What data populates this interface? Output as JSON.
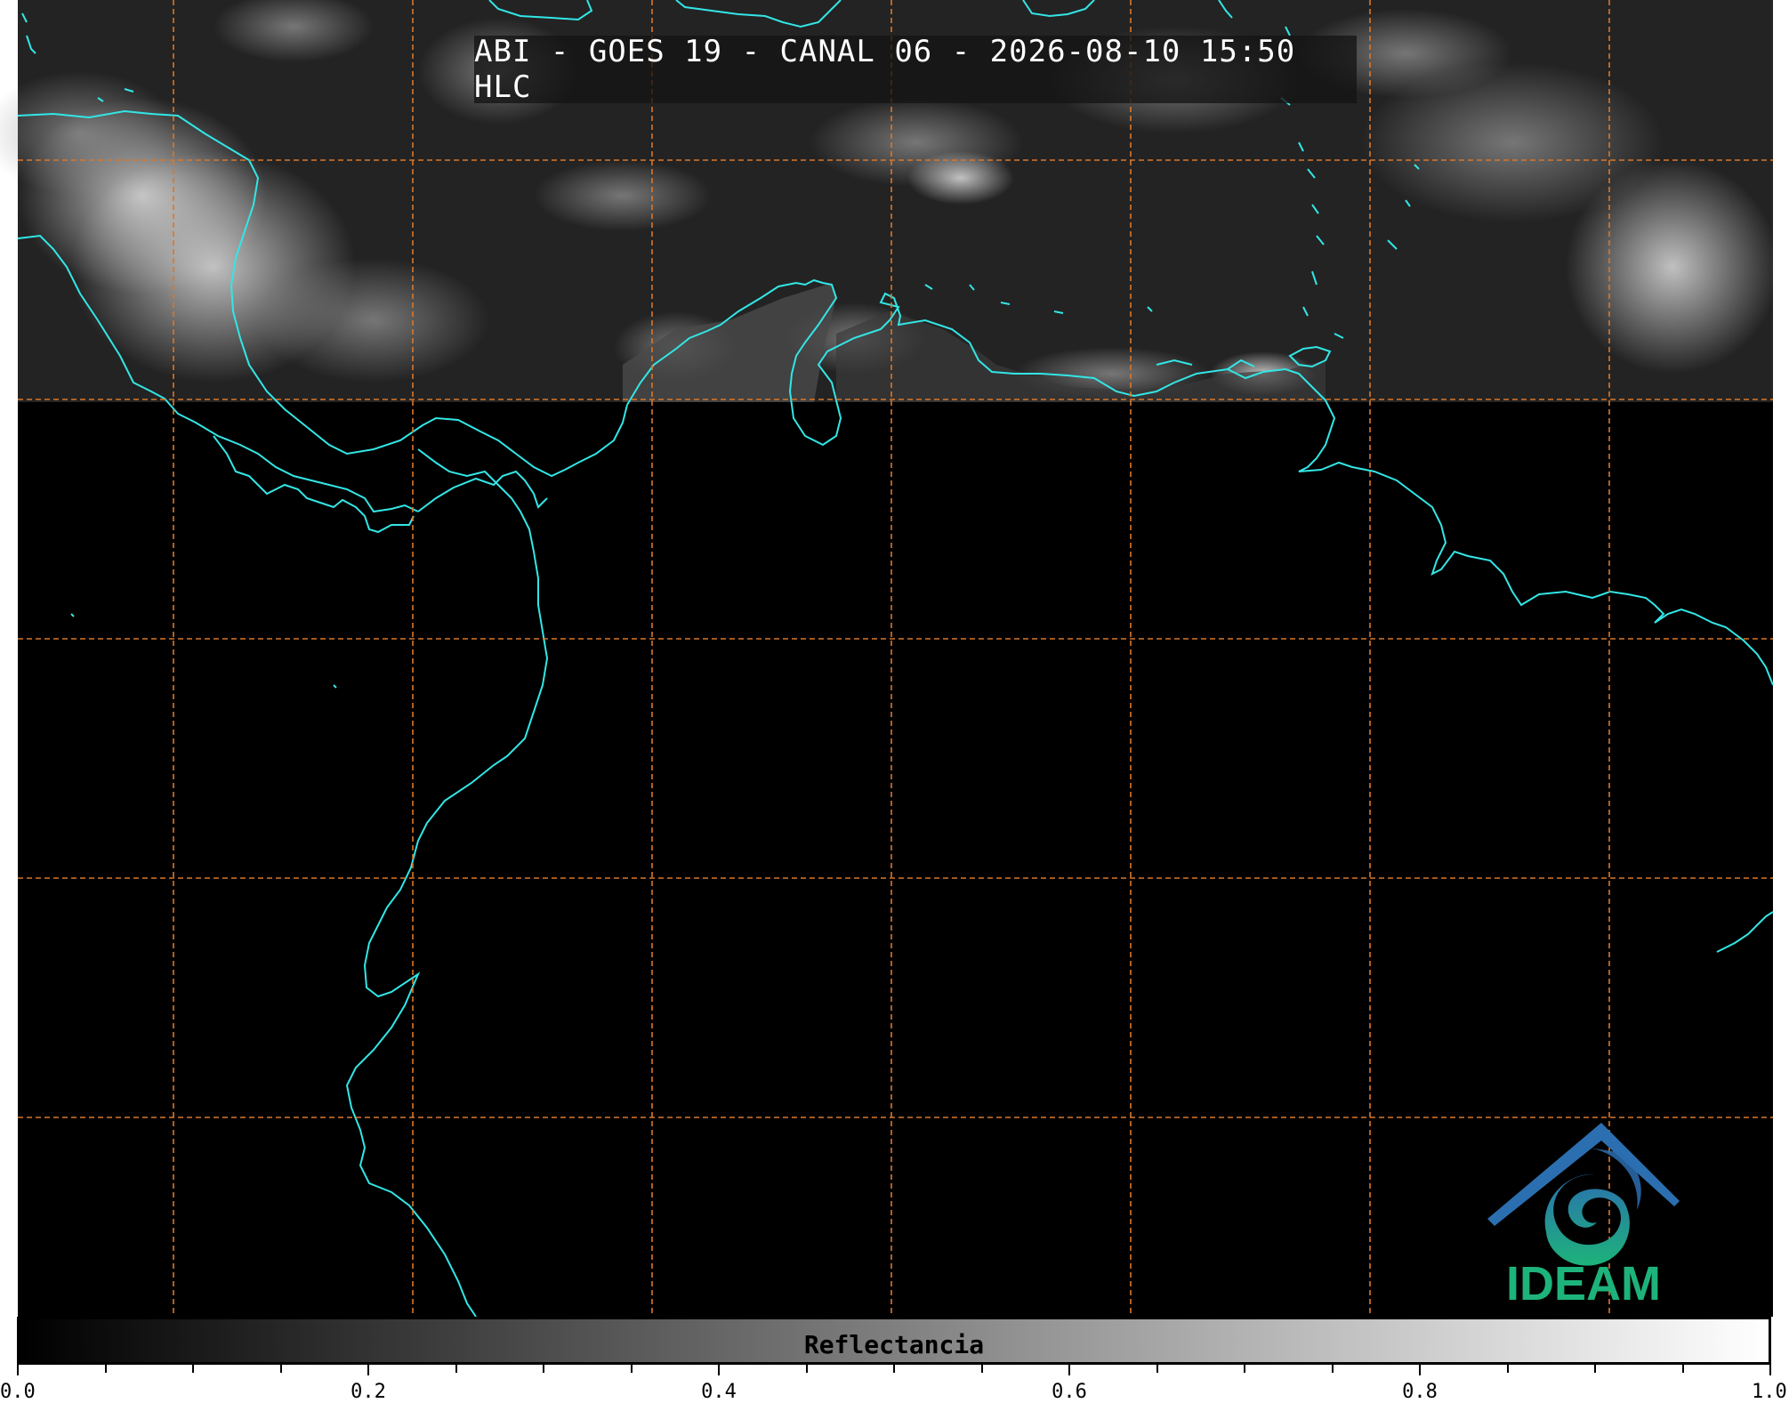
{
  "title": "ABI - GOES 19 - CANAL 06 - 2026-08-10 15:50 HLC",
  "colorbar": {
    "label": "Reflectancia",
    "range": [
      0.0,
      1.0
    ],
    "tick_labels": [
      "0.0",
      "0.2",
      "0.4",
      "0.6",
      "0.8",
      "1.0"
    ],
    "minor_tick_step": 0.05
  },
  "logo": {
    "text": "IDEAM"
  },
  "colors": {
    "coastline": "#33e6e6",
    "grid": "#d9772b",
    "background": "#000000",
    "cloud": "#d8d8d8",
    "logo_blue": "#2b6fb0",
    "logo_green": "#1db37a"
  },
  "map": {
    "grid_style": "dashed",
    "imagery_coverage": "northern band only; remainder black (no data)"
  }
}
